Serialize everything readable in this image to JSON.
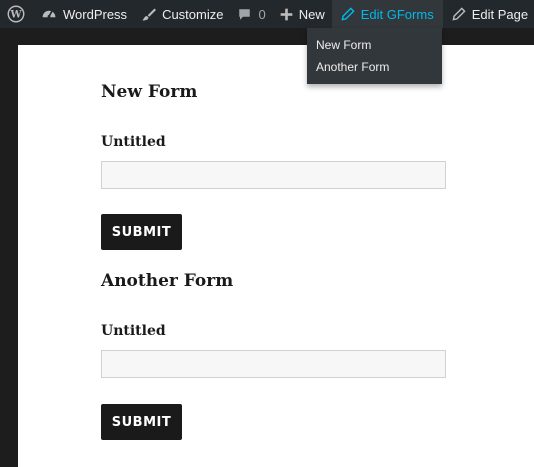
{
  "adminbar": {
    "items": [
      {
        "label": "",
        "icon": "wordpress-logo-icon"
      },
      {
        "label": "WordPress",
        "icon": "dashboard-icon"
      },
      {
        "label": "Customize",
        "icon": "paintbrush-icon"
      },
      {
        "label": "0",
        "icon": "comment-icon"
      },
      {
        "label": "New",
        "icon": "plus-icon"
      },
      {
        "label": "Edit GForms",
        "icon": "pencil-icon"
      },
      {
        "label": "Edit Page",
        "icon": "pencil-icon"
      }
    ],
    "active_color": "#00b9eb",
    "background": "#23282d"
  },
  "dropdown": {
    "items": [
      "New Form",
      "Another Form"
    ]
  },
  "forms": [
    {
      "title": "New Form",
      "field_label": "Untitled",
      "input_value": "",
      "submit_label": "SUBMIT"
    },
    {
      "title": "Another Form",
      "field_label": "Untitled",
      "input_value": "",
      "submit_label": "SUBMIT"
    }
  ]
}
